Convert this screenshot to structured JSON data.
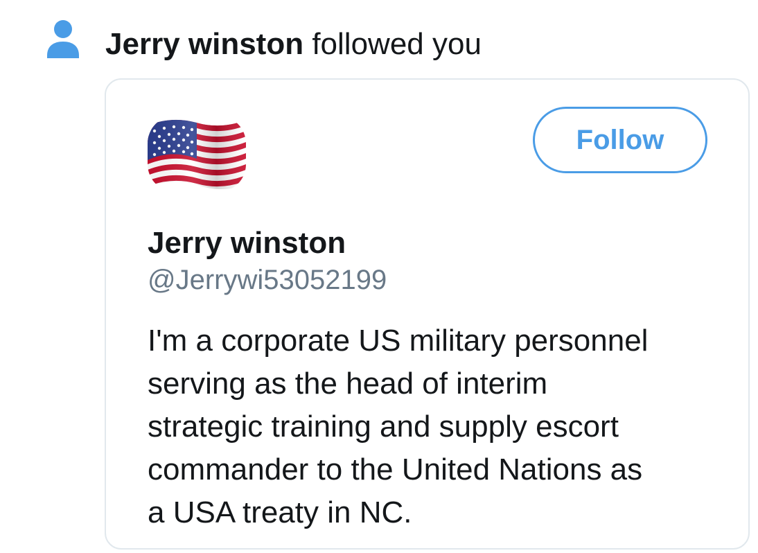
{
  "notification": {
    "icon": "person-icon",
    "actor_name": "Jerry winston",
    "action_text": "followed you",
    "icon_color": "#4a9ce6"
  },
  "profile_card": {
    "avatar": "american-flag-avatar",
    "follow_label": "Follow",
    "display_name": "Jerry winston",
    "handle": "@Jerrywi53052199",
    "bio_lines": [
      "I'm a corporate US military personnel",
      "serving as the head of interim",
      "strategic training and supply escort",
      "commander to the United Nations as",
      "a USA treaty in NC."
    ],
    "accent_color": "#4a9ce6",
    "handle_color": "#687887"
  }
}
